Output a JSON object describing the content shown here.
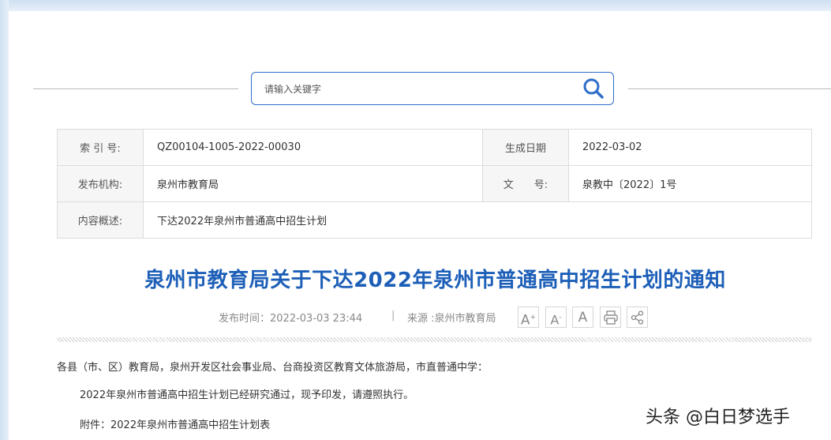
{
  "search": {
    "placeholder": "请输入关键字",
    "icon": "search-icon"
  },
  "meta": {
    "index_label": "索 引 号:",
    "index_value": "QZ00104-1005-2022-00030",
    "date_label": "生成日期",
    "date_value": "2022-03-02",
    "org_label": "发布机构:",
    "org_value": "泉州市教育局",
    "docno_label": "文　　号:",
    "docno_value": "泉教中〔2022〕1号",
    "summary_label": "内容概述:",
    "summary_value": "下达2022年泉州市普通高中招生计划"
  },
  "article": {
    "title": "泉州市教育局关于下达2022年泉州市普通高中招生计划的通知",
    "publish_time": "发布时间：2022-03-03 23:44",
    "separator": "|",
    "source": "来源 :泉州市教育局",
    "tools": {
      "font_large": "A",
      "font_medium": "A",
      "font_small": "A"
    },
    "salutation": "各县（市、区）教育局，泉州开发区社会事业局、台商投资区教育文体旅游局，市直普通中学：",
    "para1": "2022年泉州市普通高中招生计划已经研究通过，现予印发，请遵照执行。",
    "attachment": "附件：2022年泉州市普通高中招生计划表"
  },
  "watermark": "头条 @白日梦选手"
}
